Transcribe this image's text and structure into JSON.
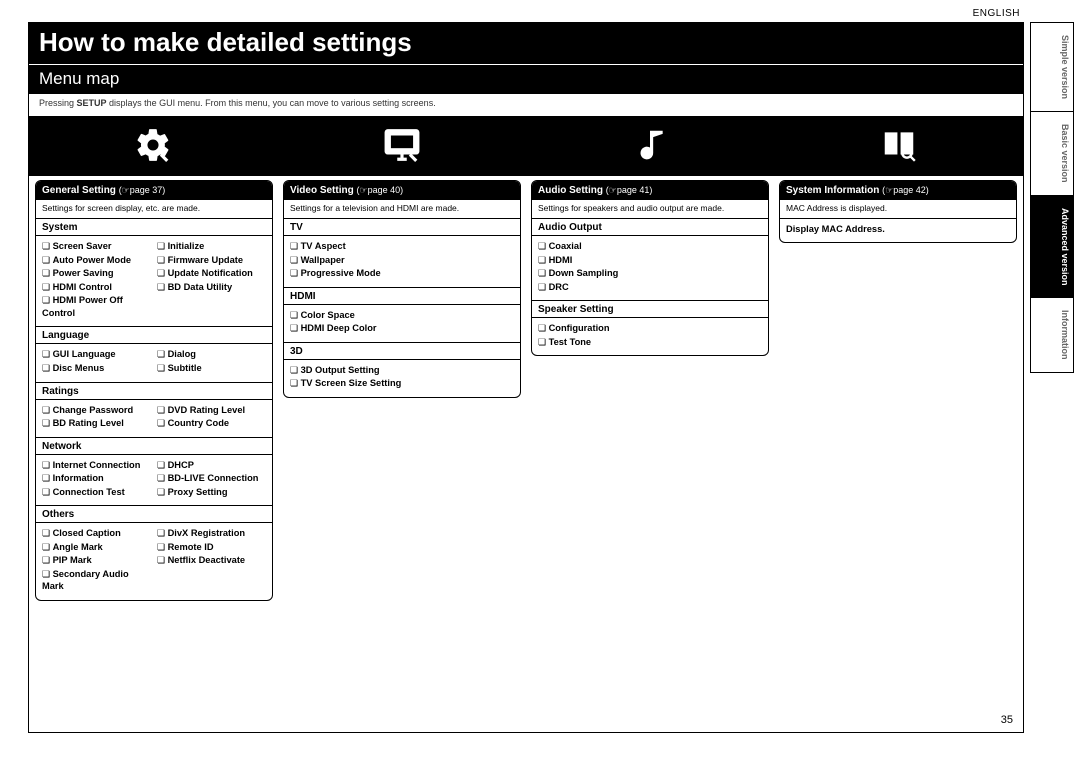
{
  "lang": "ENGLISH",
  "page_no": "35",
  "title": "How to make detailed settings",
  "subtitle": "Menu map",
  "intro_pre": "Pressing ",
  "intro_bold": "SETUP",
  "intro_post": " displays the GUI menu. From this menu, you can move to various setting screens.",
  "tabs": {
    "simple": "Simple version",
    "basic": "Basic version",
    "advanced": "Advanced version",
    "information": "Information"
  },
  "general": {
    "title": "General Setting",
    "pageref": "(☞page 37)",
    "desc": "Settings for screen display, etc. are made.",
    "sections": {
      "system": {
        "label": "System",
        "left": [
          "Screen Saver",
          "Auto Power Mode",
          "Power Saving",
          "HDMI Control",
          "HDMI Power Off Control"
        ],
        "right": [
          "Initialize",
          "Firmware Update",
          "Update Notification",
          "BD Data Utility"
        ]
      },
      "language": {
        "label": "Language",
        "left": [
          "GUI Language",
          "Disc Menus"
        ],
        "right": [
          "Dialog",
          "Subtitle"
        ]
      },
      "ratings": {
        "label": "Ratings",
        "left": [
          "Change Password",
          "BD Rating Level"
        ],
        "right": [
          "DVD Rating Level",
          "Country Code"
        ]
      },
      "network": {
        "label": "Network",
        "left": [
          "Internet Connection",
          "Information",
          "Connection Test"
        ],
        "right": [
          "DHCP",
          "BD-LIVE Connection",
          "Proxy Setting"
        ]
      },
      "others": {
        "label": "Others",
        "left": [
          "Closed Caption",
          "Angle Mark",
          "PIP Mark",
          "Secondary Audio Mark"
        ],
        "right": [
          "DivX Registration",
          "Remote ID",
          "Netflix Deactivate"
        ]
      }
    }
  },
  "video": {
    "title": "Video Setting",
    "pageref": "(☞page 40)",
    "desc": "Settings for a television and HDMI are made.",
    "sections": {
      "tv": {
        "label": "TV",
        "items": [
          "TV Aspect",
          "Wallpaper",
          "Progressive Mode"
        ]
      },
      "hdmi": {
        "label": "HDMI",
        "items": [
          "Color Space",
          "HDMI Deep Color"
        ]
      },
      "three_d": {
        "label": "3D",
        "items": [
          "3D Output Setting",
          "TV Screen Size Setting"
        ]
      }
    }
  },
  "audio": {
    "title": "Audio Setting",
    "pageref": "(☞page 41)",
    "desc": "Settings for speakers and audio output are made.",
    "sections": {
      "output": {
        "label": "Audio Output",
        "items": [
          "Coaxial",
          "HDMI",
          "Down Sampling",
          "DRC"
        ]
      },
      "speaker": {
        "label": "Speaker Setting",
        "items": [
          "Configuration",
          "Test Tone"
        ]
      }
    }
  },
  "sysinfo": {
    "title": "System Information",
    "pageref": "(☞page 42)",
    "desc": "MAC Address is displayed.",
    "body_label": "Display MAC Address."
  }
}
